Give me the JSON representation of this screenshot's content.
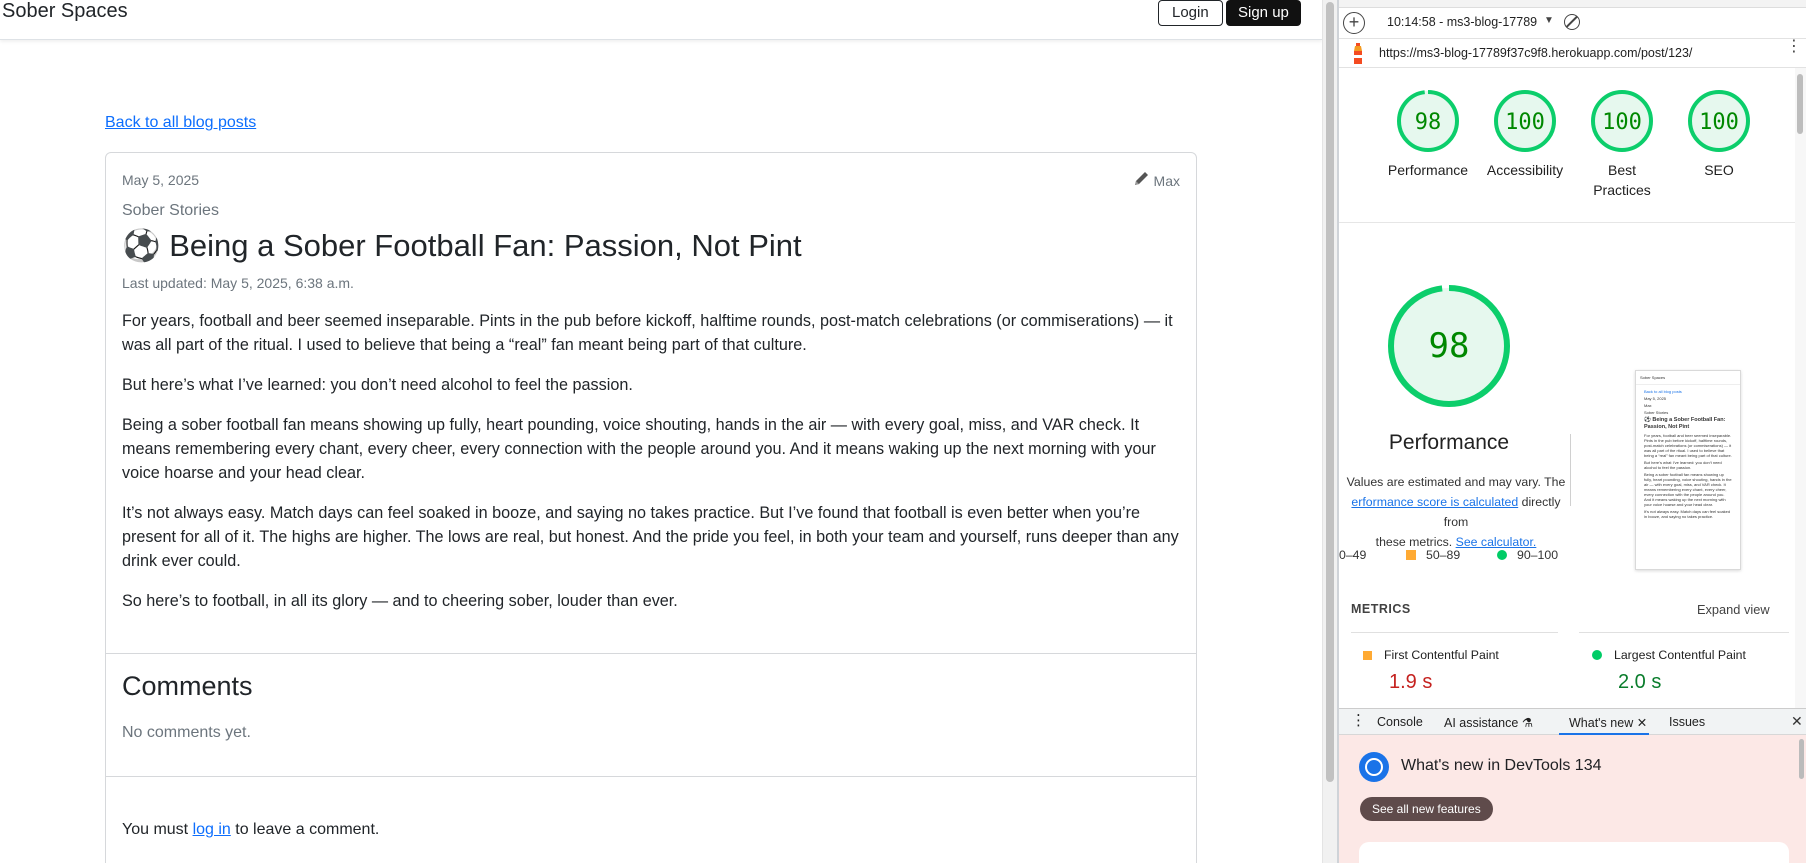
{
  "site": {
    "brand": "Sober Spaces",
    "login_label": "Login",
    "signup_label": "Sign up",
    "back_link": "Back to all blog posts"
  },
  "post": {
    "date": "May 5, 2025",
    "author": "Max",
    "category": "Sober Stories",
    "title": "⚽ Being a Sober Football Fan: Passion, Not Pint",
    "last_updated": "Last updated: May 5, 2025, 6:38 a.m.",
    "paragraphs": [
      "For years, football and beer seemed inseparable. Pints in the pub before kickoff, halftime rounds, post-match celebrations (or commiserations) — it was all part of the ritual. I used to believe that being a “real” fan meant being part of that culture.",
      "But here’s what I’ve learned: you don’t need alcohol to feel the passion.",
      "Being a sober football fan means showing up fully, heart pounding, voice shouting, hands in the air — with every goal, miss, and VAR check. It means remembering every chant, every cheer, every connection with the people around you. And it means waking up the next morning with your voice hoarse and your head clear.",
      "It’s not always easy. Match days can feel soaked in booze, and saying no takes practice. But I’ve found that football is even better when you’re present for all of it. The highs are higher. The lows are real, but honest. And the pride you feel, in both your team and yourself, runs deeper than any drink ever could.",
      "So here’s to football, in all its glory — and to cheering sober, louder than ever."
    ]
  },
  "comments": {
    "heading": "Comments",
    "empty_text": "No comments yet.",
    "login_prefix": "You must ",
    "login_link": "log in",
    "login_suffix": " to leave a comment."
  },
  "devtools": {
    "report_selector": "10:14:58 - ms3-blog-17789",
    "url": "https://ms3-blog-17789f37c9f8.herokuapp.com/post/123/",
    "scores": [
      {
        "label": "Performance",
        "value": "98"
      },
      {
        "label": "Accessibility",
        "value": "100"
      },
      {
        "label": "Best Practices",
        "value": "100"
      },
      {
        "label": "SEO",
        "value": "100"
      }
    ],
    "big_score": {
      "label": "Performance",
      "value": "98"
    },
    "values_note_1": "Values are estimated and may vary. The",
    "values_note_link": "erformance score is calculated",
    "values_note_2": " directly from",
    "values_note_3": "these metrics. ",
    "calculator_link": "See calculator.",
    "legend": {
      "low": "0–49",
      "mid": "50–89",
      "high": "90–100"
    },
    "metrics_header": "METRICS",
    "expand_view": "Expand view",
    "metrics": [
      {
        "name": "First Contentful Paint",
        "value": "1.9 s",
        "color": "#c5221f"
      },
      {
        "name": "Largest Contentful Paint",
        "value": "2.0 s",
        "color": "#0a7d2c"
      }
    ],
    "colors": {
      "pass": "#0cce6b",
      "average": "#ffa400",
      "pass_bg": "#e6f8ee",
      "pass_text": "#008800"
    },
    "drawer_tabs": [
      "Console",
      "AI assistance",
      "What's new",
      "Issues"
    ],
    "whats_new_title": "What's new in DevTools 134",
    "whats_new_button": "See all new features",
    "thumbnail": {
      "brand": "Sober Spaces",
      "back": "Back to all blog posts",
      "date": "May 5, 2025",
      "author": "Max",
      "category": "Sober Stories",
      "title": "⚽ Being a Sober Football Fan: Passion, Not Pint",
      "p1": "For years, football and beer seemed inseparable. Pints in the pub before kickoff, halftime rounds, post-match celebrations (or commiserations) — it was all part of the ritual. I used to believe that being a “real” fan meant being part of that culture.",
      "p2": "But here’s what I’ve learned: you don’t need alcohol to feel the passion.",
      "p3": "Being a sober football fan means showing up fully, heart pounding, voice shouting, hands in the air — with every goal, miss, and VAR check. It means remembering every chant, every cheer, every connection with the people around you. And it means waking up the next morning with your voice hoarse and your head clear.",
      "p4": "It’s not always easy. Match days can feel soaked in booze, and saying no takes practice."
    }
  }
}
